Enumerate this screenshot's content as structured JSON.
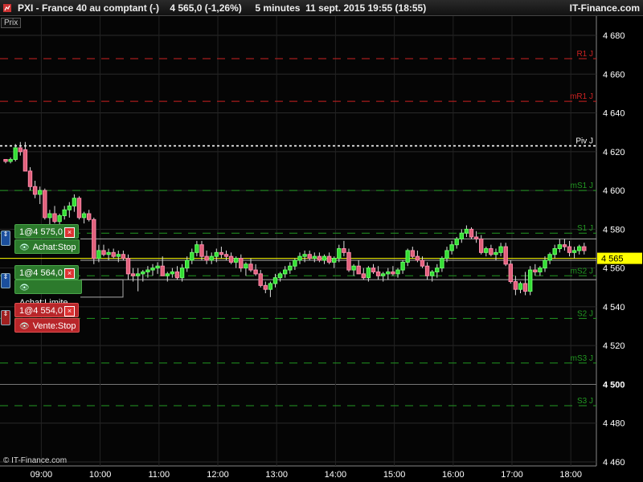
{
  "window": {
    "title": "PXI - France 40 au comptant (-)    4 565,0 (-1,26%)     5 minutes  11 sept. 2015 19:55 (18:55)",
    "brand": "IT-Finance.com",
    "price_label": "Prix",
    "copyright": "© IT-Finance.com"
  },
  "orders": [
    {
      "label": "1@4 575,0",
      "action": "Achat:Stop",
      "color": "green",
      "price": 4575
    },
    {
      "label": "1@4 564,0",
      "action": "Achat:Limite",
      "color": "green",
      "price": 4564
    },
    {
      "label": "1@4 554,0",
      "action": "Vente:Stop",
      "color": "red",
      "price": 4554
    }
  ],
  "chart_data": {
    "type": "candlestick",
    "ylim": [
      4455,
      4690
    ],
    "yticks": [
      4460,
      4480,
      4500,
      4520,
      4540,
      4560,
      4580,
      4600,
      4620,
      4640,
      4660,
      4680
    ],
    "ytick_labels": [
      "4 460",
      "4 480",
      "4 500",
      "4 520",
      "4 540",
      "4 560",
      "4 580",
      "4 600",
      "4 620",
      "4 640",
      "4 660",
      "4 680"
    ],
    "xticks": [
      "09:00",
      "10:00",
      "11:00",
      "12:00",
      "13:00",
      "14:00",
      "15:00",
      "16:00",
      "17:00",
      "18:00"
    ],
    "current_price": 4565,
    "current_price_label": "4 565",
    "pivot_levels": [
      {
        "name": "R1 J",
        "value": 4668,
        "color": "#cc2222"
      },
      {
        "name": "mR1 J",
        "value": 4646,
        "color": "#cc2222"
      },
      {
        "name": "Piv J",
        "value": 4623,
        "color": "#ffffff"
      },
      {
        "name": "mS1 J",
        "value": 4600,
        "color": "#229922"
      },
      {
        "name": "S1 J",
        "value": 4578,
        "color": "#229922"
      },
      {
        "name": "mS2 J",
        "value": 4556,
        "color": "#229922"
      },
      {
        "name": "S2 J",
        "value": 4534,
        "color": "#229922"
      },
      {
        "name": "mS3 J",
        "value": 4511,
        "color": "#229922"
      },
      {
        "name": "S3 J",
        "value": 4489,
        "color": "#229922"
      }
    ],
    "candles": [
      [
        4616,
        4616,
        4614,
        4615
      ],
      [
        4615,
        4617,
        4614,
        4616
      ],
      [
        4616,
        4624,
        4615,
        4622
      ],
      [
        4622,
        4625,
        4618,
        4620
      ],
      [
        4621,
        4625,
        4610,
        4610
      ],
      [
        4610,
        4612,
        4600,
        4602
      ],
      [
        4602,
        4605,
        4596,
        4598
      ],
      [
        4598,
        4602,
        4593,
        4600
      ],
      [
        4600,
        4601,
        4585,
        4586
      ],
      [
        4586,
        4590,
        4581,
        4588
      ],
      [
        4588,
        4592,
        4583,
        4584
      ],
      [
        4584,
        4588,
        4582,
        4587
      ],
      [
        4587,
        4592,
        4585,
        4590
      ],
      [
        4590,
        4594,
        4586,
        4592
      ],
      [
        4592,
        4598,
        4589,
        4596
      ],
      [
        4596,
        4597,
        4585,
        4586
      ],
      [
        4586,
        4589,
        4583,
        4588
      ],
      [
        4588,
        4590,
        4584,
        4585
      ],
      [
        4585,
        4586,
        4562,
        4565
      ],
      [
        4565,
        4572,
        4563,
        4569
      ],
      [
        4569,
        4572,
        4566,
        4567
      ],
      [
        4567,
        4570,
        4564,
        4568
      ],
      [
        4568,
        4570,
        4565,
        4566
      ],
      [
        4566,
        4569,
        4563,
        4567
      ],
      [
        4567,
        4569,
        4564,
        4565
      ],
      [
        4565,
        4567,
        4554,
        4557
      ],
      [
        4557,
        4560,
        4553,
        4556
      ],
      [
        4556,
        4560,
        4548,
        4557
      ],
      [
        4557,
        4559,
        4553,
        4558
      ],
      [
        4558,
        4561,
        4555,
        4559
      ],
      [
        4559,
        4562,
        4556,
        4560
      ],
      [
        4560,
        4563,
        4557,
        4561
      ],
      [
        4561,
        4566,
        4559,
        4556
      ],
      [
        4556,
        4558,
        4553,
        4557
      ],
      [
        4557,
        4560,
        4555,
        4558
      ],
      [
        4558,
        4561,
        4554,
        4555
      ],
      [
        4555,
        4562,
        4553,
        4560
      ],
      [
        4560,
        4566,
        4558,
        4564
      ],
      [
        4564,
        4570,
        4562,
        4568
      ],
      [
        4568,
        4574,
        4566,
        4572
      ],
      [
        4572,
        4574,
        4564,
        4566
      ],
      [
        4566,
        4569,
        4562,
        4564
      ],
      [
        4564,
        4568,
        4562,
        4566
      ],
      [
        4566,
        4570,
        4563,
        4568
      ],
      [
        4568,
        4571,
        4565,
        4567
      ],
      [
        4567,
        4569,
        4564,
        4566
      ],
      [
        4566,
        4568,
        4562,
        4563
      ],
      [
        4563,
        4566,
        4560,
        4565
      ],
      [
        4565,
        4567,
        4558,
        4560
      ],
      [
        4560,
        4563,
        4556,
        4562
      ],
      [
        4562,
        4565,
        4558,
        4559
      ],
      [
        4559,
        4562,
        4556,
        4557
      ],
      [
        4557,
        4559,
        4550,
        4551
      ],
      [
        4551,
        4553,
        4547,
        4549
      ],
      [
        4549,
        4553,
        4545,
        4552
      ],
      [
        4552,
        4557,
        4550,
        4555
      ],
      [
        4555,
        4558,
        4553,
        4557
      ],
      [
        4557,
        4561,
        4555,
        4559
      ],
      [
        4559,
        4563,
        4557,
        4561
      ],
      [
        4561,
        4565,
        4559,
        4564
      ],
      [
        4564,
        4568,
        4562,
        4566
      ],
      [
        4566,
        4569,
        4563,
        4567
      ],
      [
        4567,
        4569,
        4564,
        4565
      ],
      [
        4565,
        4568,
        4563,
        4566
      ],
      [
        4566,
        4568,
        4563,
        4564
      ],
      [
        4564,
        4567,
        4562,
        4566
      ],
      [
        4566,
        4568,
        4562,
        4563
      ],
      [
        4563,
        4566,
        4560,
        4565
      ],
      [
        4565,
        4572,
        4563,
        4570
      ],
      [
        4570,
        4574,
        4566,
        4568
      ],
      [
        4568,
        4570,
        4558,
        4559
      ],
      [
        4559,
        4562,
        4556,
        4561
      ],
      [
        4561,
        4564,
        4558,
        4557
      ],
      [
        4557,
        4560,
        4554,
        4555
      ],
      [
        4555,
        4561,
        4553,
        4560
      ],
      [
        4560,
        4562,
        4557,
        4558
      ],
      [
        4558,
        4561,
        4554,
        4556
      ],
      [
        4556,
        4558,
        4553,
        4557
      ],
      [
        4557,
        4560,
        4554,
        4558
      ],
      [
        4558,
        4561,
        4556,
        4557
      ],
      [
        4557,
        4560,
        4555,
        4559
      ],
      [
        4559,
        4564,
        4557,
        4563
      ],
      [
        4563,
        4570,
        4561,
        4569
      ],
      [
        4569,
        4571,
        4565,
        4566
      ],
      [
        4566,
        4569,
        4563,
        4564
      ],
      [
        4564,
        4566,
        4560,
        4561
      ],
      [
        4561,
        4563,
        4554,
        4556
      ],
      [
        4556,
        4559,
        4553,
        4558
      ],
      [
        4558,
        4562,
        4555,
        4560
      ],
      [
        4560,
        4566,
        4558,
        4565
      ],
      [
        4565,
        4571,
        4563,
        4569
      ],
      [
        4569,
        4574,
        4567,
        4572
      ],
      [
        4572,
        4576,
        4570,
        4575
      ],
      [
        4575,
        4580,
        4573,
        4578
      ],
      [
        4578,
        4582,
        4576,
        4580
      ],
      [
        4580,
        4581,
        4575,
        4576
      ],
      [
        4576,
        4579,
        4573,
        4575
      ],
      [
        4575,
        4577,
        4567,
        4568
      ],
      [
        4568,
        4571,
        4566,
        4570
      ],
      [
        4570,
        4572,
        4566,
        4567
      ],
      [
        4567,
        4570,
        4564,
        4568
      ],
      [
        4568,
        4573,
        4566,
        4571
      ],
      [
        4571,
        4573,
        4561,
        4562
      ],
      [
        4562,
        4564,
        4552,
        4553
      ],
      [
        4553,
        4556,
        4546,
        4549
      ],
      [
        4549,
        4553,
        4547,
        4552
      ],
      [
        4552,
        4558,
        4546,
        4548
      ],
      [
        4548,
        4561,
        4546,
        4559
      ],
      [
        4559,
        4562,
        4556,
        4558
      ],
      [
        4558,
        4561,
        4556,
        4560
      ],
      [
        4560,
        4566,
        4558,
        4564
      ],
      [
        4564,
        4568,
        4562,
        4567
      ],
      [
        4567,
        4572,
        4565,
        4570
      ],
      [
        4570,
        4575,
        4568,
        4572
      ],
      [
        4572,
        4575,
        4569,
        4571
      ],
      [
        4571,
        4574,
        4566,
        4568
      ],
      [
        4568,
        4571,
        4565,
        4569
      ],
      [
        4569,
        4572,
        4567,
        4571
      ],
      [
        4571,
        4573,
        4567,
        4569
      ]
    ]
  }
}
